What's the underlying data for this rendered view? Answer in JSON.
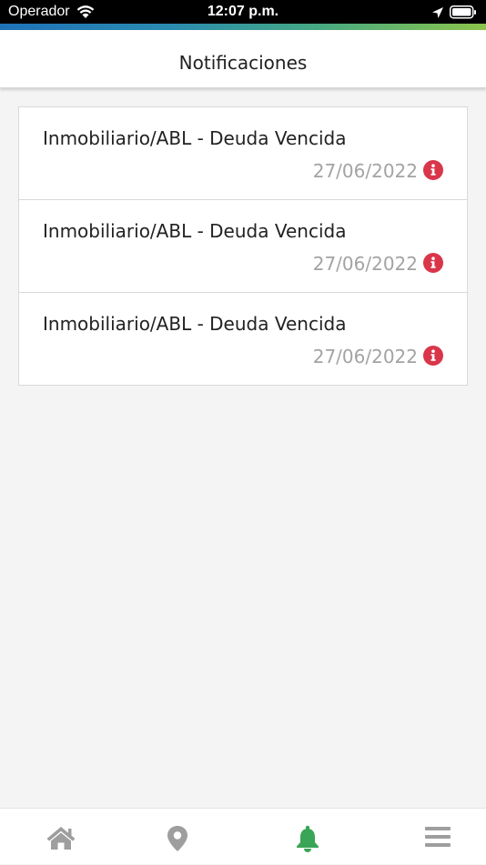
{
  "status_bar": {
    "carrier": "Operador",
    "time": "12:07 p.m."
  },
  "header": {
    "title": "Notificaciones"
  },
  "notifications": [
    {
      "title": "Inmobiliario/ABL - Deuda Vencida",
      "date": "27/06/2022",
      "icon": "info-icon"
    },
    {
      "title": "Inmobiliario/ABL - Deuda Vencida",
      "date": "27/06/2022",
      "icon": "info-icon"
    },
    {
      "title": "Inmobiliario/ABL - Deuda Vencida",
      "date": "27/06/2022",
      "icon": "info-icon"
    }
  ],
  "tab_bar": {
    "items": [
      {
        "icon": "home-icon",
        "active": false
      },
      {
        "icon": "map-pin-icon",
        "active": false
      },
      {
        "icon": "bell-icon",
        "active": true
      },
      {
        "icon": "menu-icon",
        "active": false
      }
    ]
  },
  "colors": {
    "accent_active": "#3aa457",
    "inactive_icon": "#9e9e9e",
    "alert": "#d9364a",
    "date_text": "#a3a3a3"
  }
}
